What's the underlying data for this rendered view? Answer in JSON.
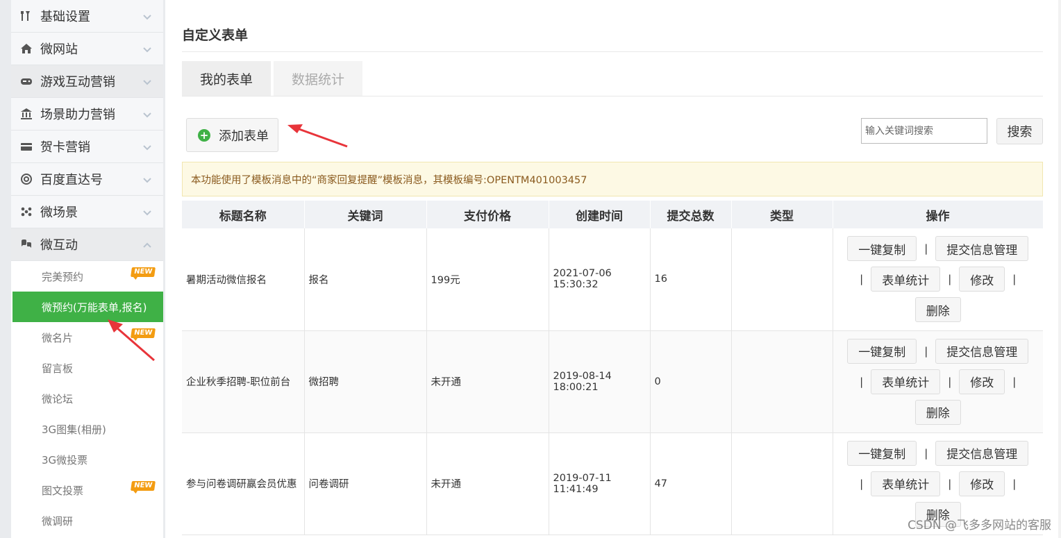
{
  "sidebar": {
    "menu": [
      {
        "label": "基础设置",
        "icon": "tools-icon"
      },
      {
        "label": "微网站",
        "icon": "home-icon"
      },
      {
        "label": "游戏互动营销",
        "icon": "gamepad-icon"
      },
      {
        "label": "场景助力营销",
        "icon": "bank-icon"
      },
      {
        "label": "贺卡营销",
        "icon": "card-icon"
      },
      {
        "label": "百度直达号",
        "icon": "at-icon"
      },
      {
        "label": "微场景",
        "icon": "dots-icon"
      },
      {
        "label": "微互动",
        "icon": "chat-icon"
      }
    ],
    "sub_items": [
      {
        "label": "完美预约",
        "badge": "NEW"
      },
      {
        "label": "微预约(万能表单,报名)",
        "badge": ""
      },
      {
        "label": "微名片",
        "badge": "NEW"
      },
      {
        "label": "留言板",
        "badge": ""
      },
      {
        "label": "微论坛",
        "badge": ""
      },
      {
        "label": "3G图集(相册)",
        "badge": ""
      },
      {
        "label": "3G微投票",
        "badge": ""
      },
      {
        "label": "图文投票",
        "badge": "NEW"
      },
      {
        "label": "微调研",
        "badge": ""
      }
    ]
  },
  "main": {
    "title": "自定义表单",
    "tabs": [
      {
        "label": "我的表单"
      },
      {
        "label": "数据统计"
      }
    ],
    "add_button": "添加表单",
    "search": {
      "placeholder": "输入关键词搜索",
      "button": "搜索"
    },
    "notice": "本功能使用了模板消息中的“商家回复提醒”模板消息，其模板编号:OPENTM401003457",
    "table": {
      "headers": [
        "标题名称",
        "关键词",
        "支付价格",
        "创建时间",
        "提交总数",
        "类型",
        "操作"
      ],
      "rows": [
        {
          "title": "暑期活动微信报名",
          "keyword": "报名",
          "price": "199元",
          "created": "2021-07-06 15:30:32",
          "total": "16",
          "type": ""
        },
        {
          "title": "企业秋季招聘-职位前台",
          "keyword": "微招聘",
          "price": "未开通",
          "created": "2019-08-14 18:00:21",
          "total": "0",
          "type": ""
        },
        {
          "title": "参与问卷调研赢会员优惠",
          "keyword": "问卷调研",
          "price": "未开通",
          "created": "2019-07-11 11:41:49",
          "total": "47",
          "type": ""
        }
      ],
      "actions": {
        "copy": "一键复制",
        "manage": "提交信息管理",
        "stats": "表单统计",
        "edit": "修改",
        "delete": "删除",
        "separator": "|"
      }
    }
  },
  "watermark": "CSDN @飞多多网站的客服",
  "colors": {
    "accent_green": "#3fb146",
    "arrow_red": "#e8343a",
    "badge_orange": "#f39c12"
  }
}
